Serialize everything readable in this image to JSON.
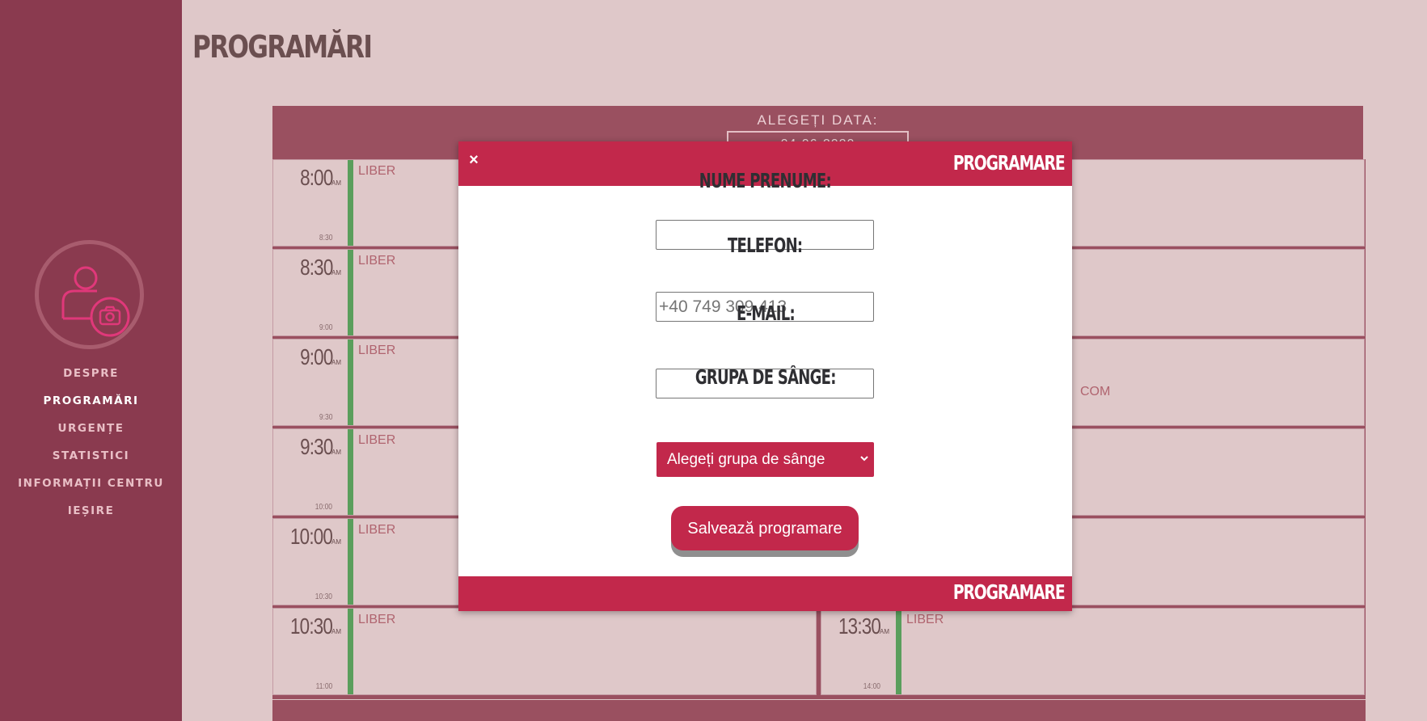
{
  "sidebar": {
    "avatar_icon": "user-camera-icon",
    "nav": [
      {
        "label": "DESPRE"
      },
      {
        "label": "PROGRAMĂRI"
      },
      {
        "label": "URGENȚE"
      },
      {
        "label": "STATISTICI"
      },
      {
        "label": "INFORMAȚII CENTRU"
      },
      {
        "label": "IEȘIRE"
      }
    ],
    "active_index": 1
  },
  "page": {
    "title": "PROGRAMĂRI"
  },
  "calendar": {
    "date_label": "ALEGEȚI DATA:",
    "date_value": "04-06-2020",
    "left_slots": [
      {
        "time": "8:00",
        "ampm": "AM",
        "end": "8:30",
        "status": "LIBER"
      },
      {
        "time": "8:30",
        "ampm": "AM",
        "end": "9:00",
        "status": "LIBER"
      },
      {
        "time": "9:00",
        "ampm": "AM",
        "end": "9:30",
        "status": "LIBER"
      },
      {
        "time": "9:30",
        "ampm": "AM",
        "end": "10:00",
        "status": "LIBER"
      },
      {
        "time": "10:00",
        "ampm": "AM",
        "end": "10:30",
        "status": "LIBER"
      },
      {
        "time": "10:30",
        "ampm": "AM",
        "end": "11:00",
        "status": "LIBER"
      }
    ],
    "right_slots": [
      {
        "time": "",
        "ampm": "",
        "end": "",
        "status": "",
        "extra": ""
      },
      {
        "time": "",
        "ampm": "",
        "end": "",
        "status": "",
        "extra": ""
      },
      {
        "time": "",
        "ampm": "",
        "end": "",
        "status": "",
        "extra": "COM"
      },
      {
        "time": "",
        "ampm": "",
        "end": "",
        "status": "",
        "extra": ""
      },
      {
        "time": "",
        "ampm": "",
        "end": "",
        "status": "",
        "extra": ""
      },
      {
        "time": "13:30",
        "ampm": "AM",
        "end": "14:00",
        "status": "LIBER",
        "extra": ""
      }
    ]
  },
  "modal": {
    "title": "PROGRAMARE",
    "footer_title": "PROGRAMARE",
    "close_label": "×",
    "name_label": "NUME PRENUME:",
    "name_value": "",
    "phone_label": "TELEFON:",
    "phone_placeholder": "+40 749 309 413",
    "email_label": "E-MAIL:",
    "email_value": "",
    "blood_label": "GRUPA DE SÂNGE:",
    "blood_select": "Alegeți grupa de sânge",
    "save_label": "Salvează programare"
  },
  "colors": {
    "sidebar": "#8a3a4f",
    "background": "#dfc8c9",
    "accent": "#c2284b",
    "free_bar": "#5a9e5c"
  }
}
